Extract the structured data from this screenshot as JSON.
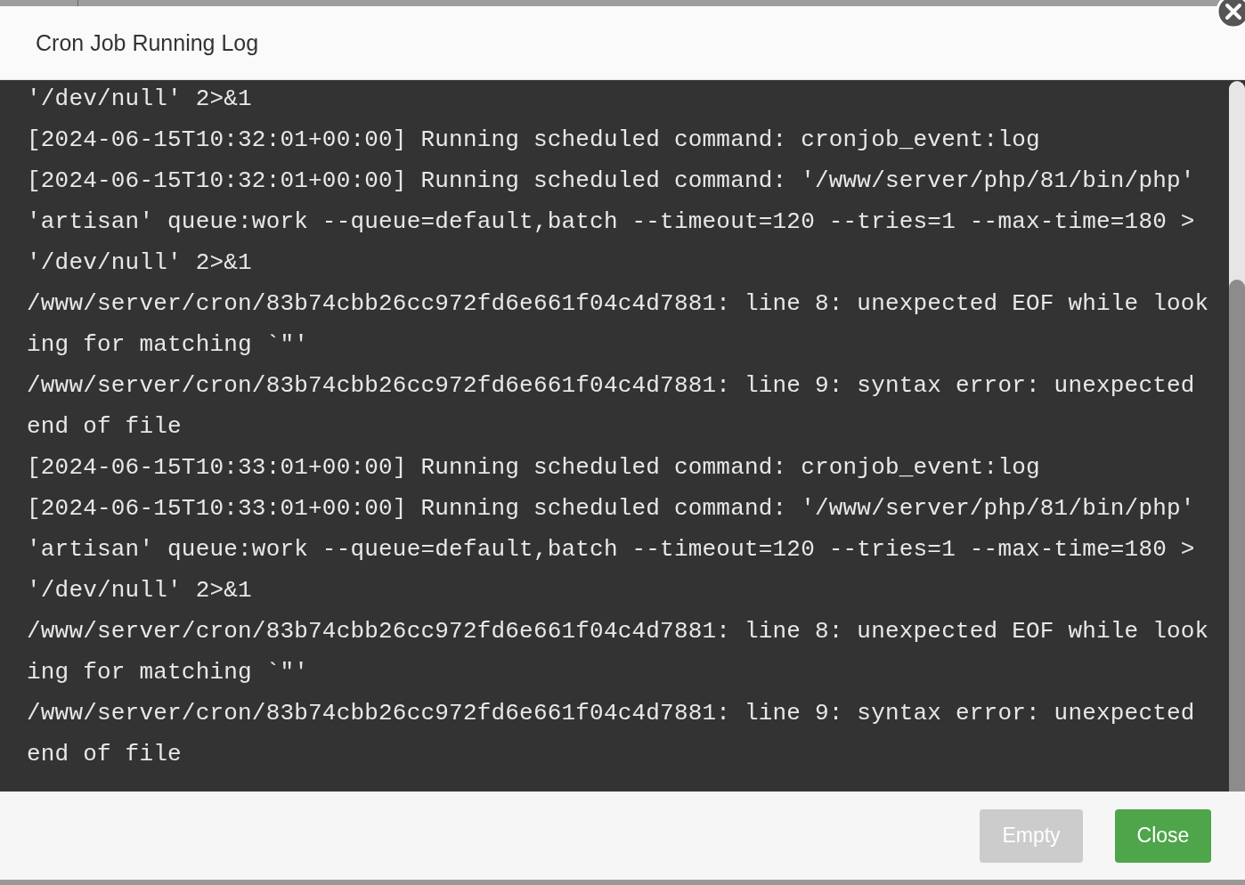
{
  "dialog": {
    "title": "Cron Job Running Log",
    "log_lines": [
      "'/dev/null' 2>&1",
      "[2024-06-15T10:32:01+00:00] Running scheduled command: cronjob_event:log",
      "[2024-06-15T10:32:01+00:00] Running scheduled command: '/www/server/php/81/bin/php'",
      "'artisan' queue:work --queue=default,batch --timeout=120 --tries=1 --max-time=180 >",
      "'/dev/null' 2>&1",
      "/www/server/cron/83b74cbb26cc972fd6e661f04c4d7881: line 8: unexpected EOF while look",
      "ing for matching `\"'",
      "/www/server/cron/83b74cbb26cc972fd6e661f04c4d7881: line 9: syntax error: unexpected",
      "end of file",
      "[2024-06-15T10:33:01+00:00] Running scheduled command: cronjob_event:log",
      "[2024-06-15T10:33:01+00:00] Running scheduled command: '/www/server/php/81/bin/php'",
      "'artisan' queue:work --queue=default,batch --timeout=120 --tries=1 --max-time=180 >",
      "'/dev/null' 2>&1",
      "/www/server/cron/83b74cbb26cc972fd6e661f04c4d7881: line 8: unexpected EOF while look",
      "ing for matching `\"'",
      "/www/server/cron/83b74cbb26cc972fd6e661f04c4d7881: line 9: syntax error: unexpected",
      "end of file"
    ],
    "buttons": [
      {
        "label": "Empty",
        "disabled": true
      },
      {
        "label": "Close",
        "disabled": false
      }
    ]
  }
}
